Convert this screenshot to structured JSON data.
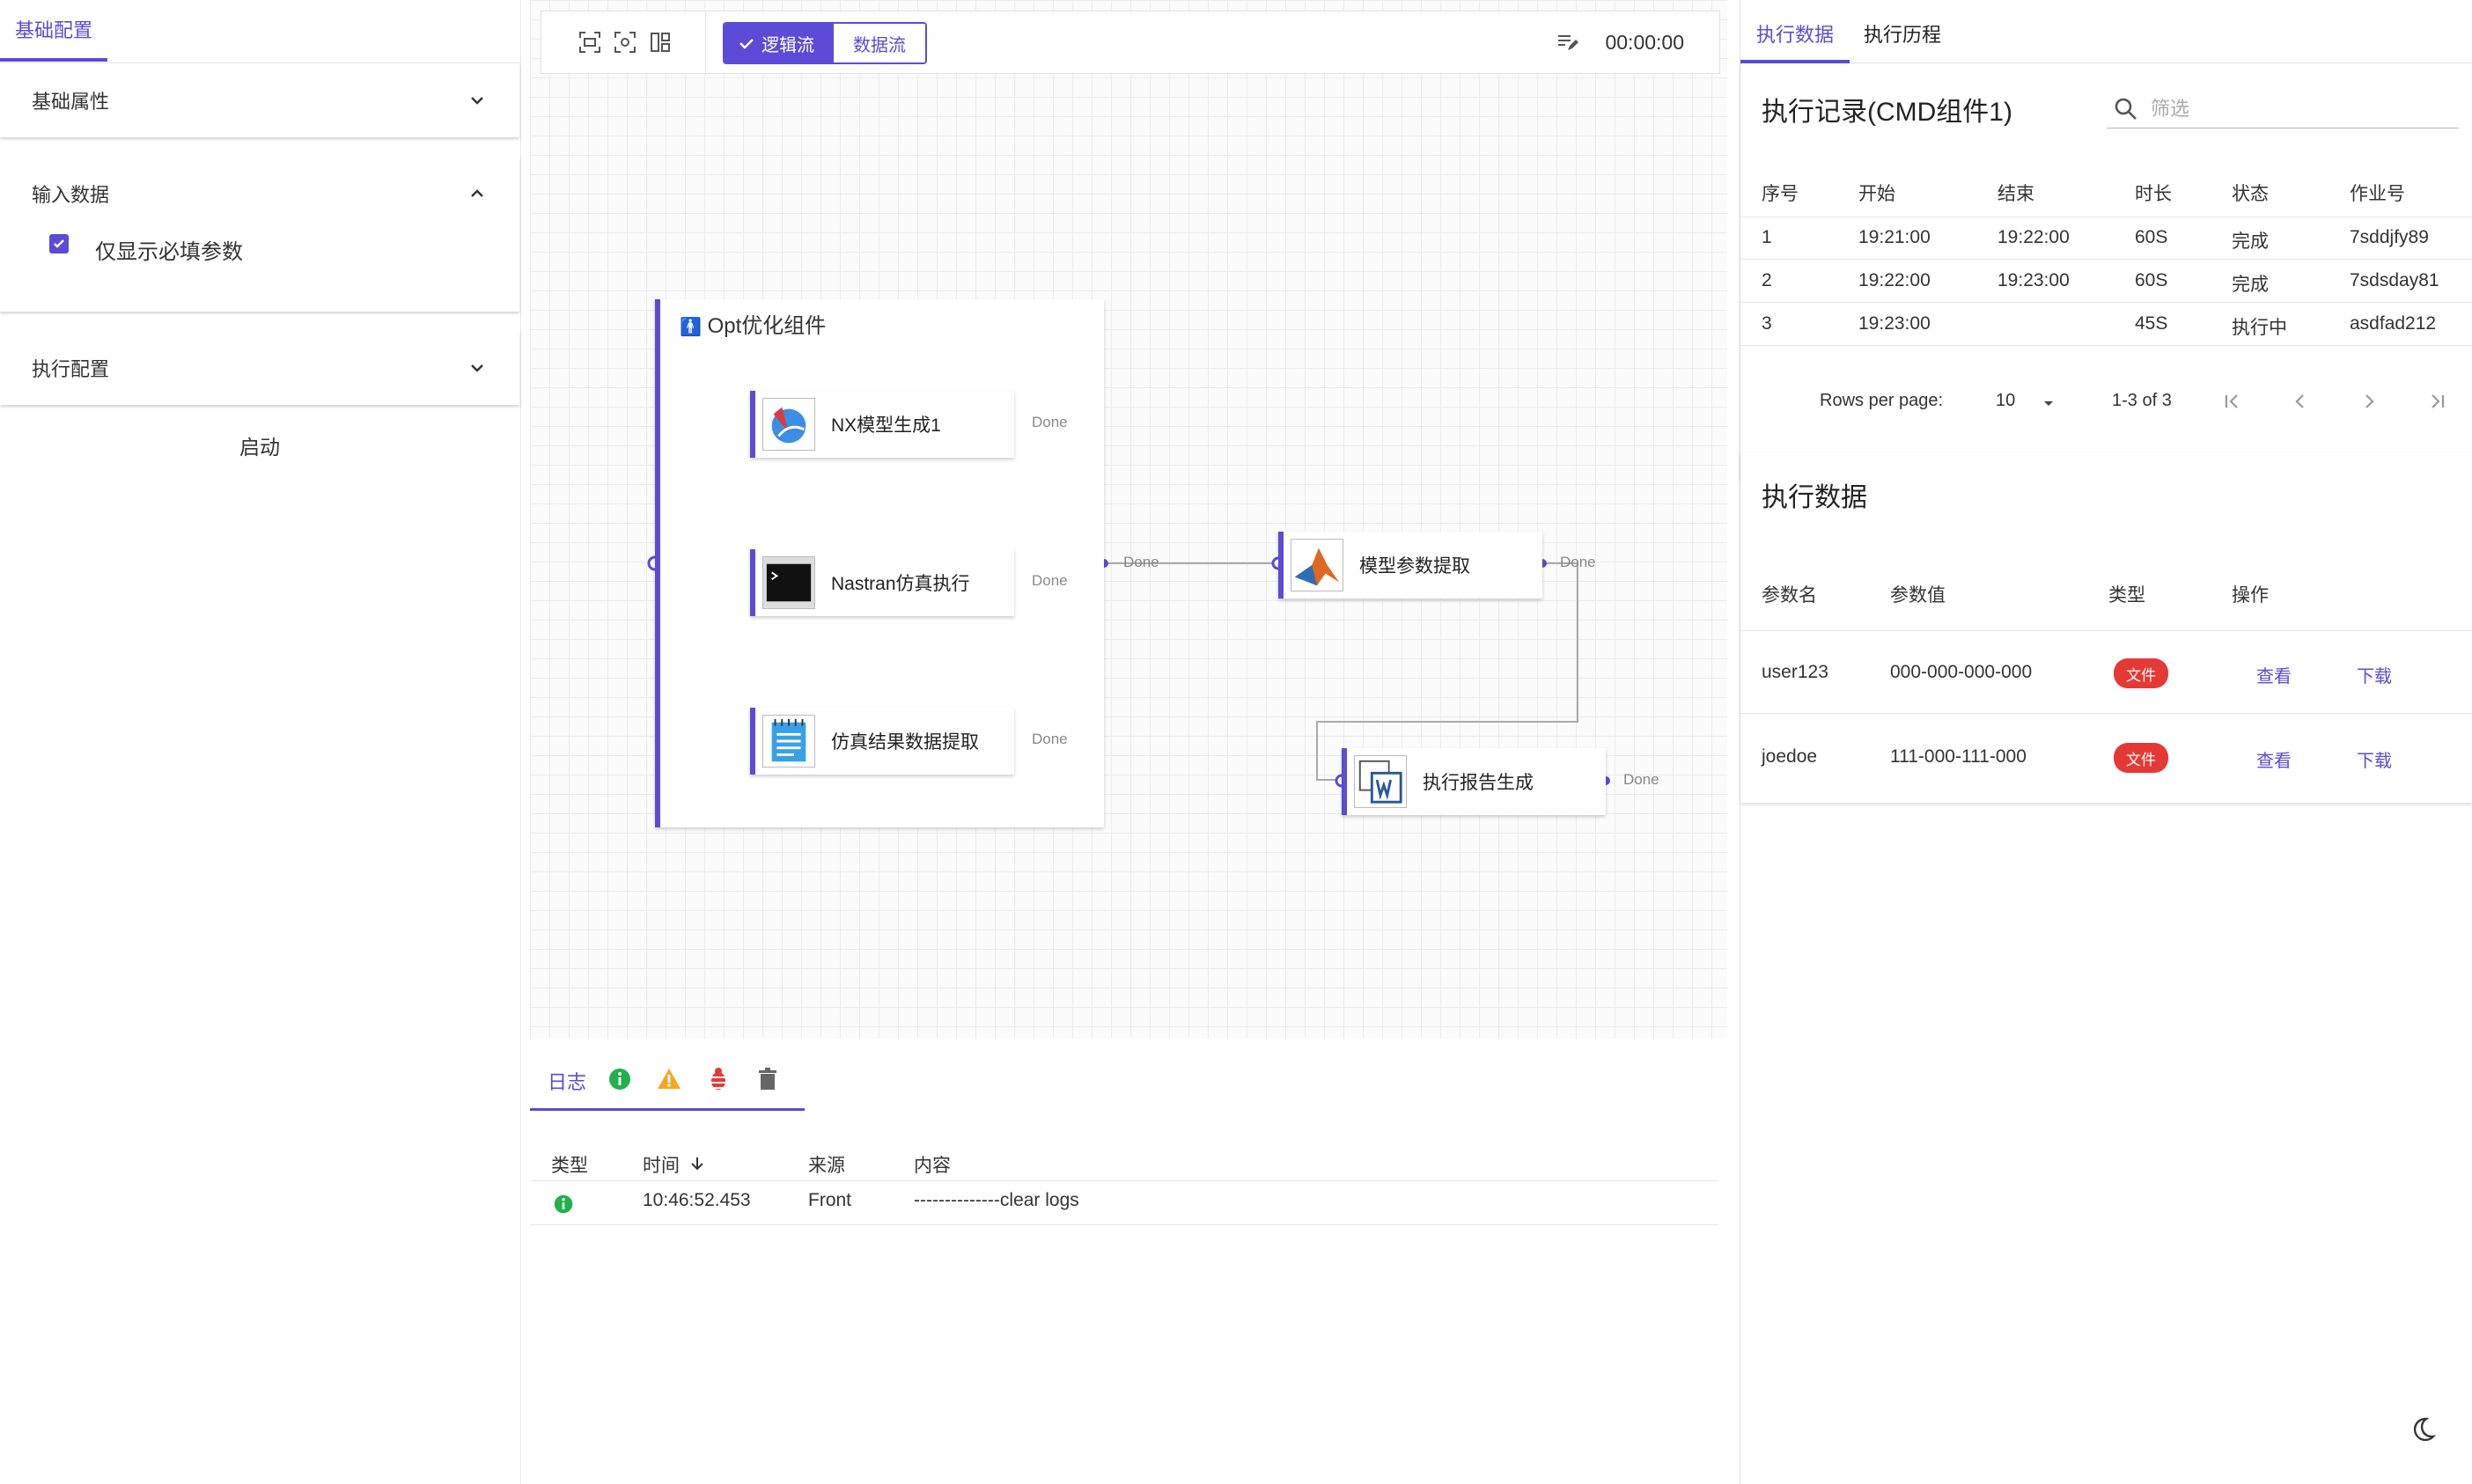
{
  "left_panel": {
    "tab": "基础配置",
    "sections": [
      {
        "label": "基础属性"
      },
      {
        "label": "输入数据"
      },
      {
        "label": "执行配置"
      }
    ],
    "checkbox_label": "仅显示必填参数",
    "start_button": "启动"
  },
  "toolbar": {
    "logic_flow": "逻辑流",
    "data_flow": "数据流",
    "timer": "00:00:00"
  },
  "canvas": {
    "group_title": "Opt优化组件",
    "nodes": [
      {
        "label": "NX模型生成1",
        "port": "Done"
      },
      {
        "label": "Nastran仿真执行",
        "port": "Done"
      },
      {
        "label": "仿真结果数据提取",
        "port": "Done"
      },
      {
        "label": "模型参数提取",
        "port": "Done"
      },
      {
        "label": "执行报告生成",
        "port": "Done"
      }
    ],
    "group_port": "Done"
  },
  "log": {
    "tab": "日志",
    "headers": [
      "类型",
      "时间",
      "来源",
      "内容"
    ],
    "rows": [
      {
        "time": "10:46:52.453",
        "source": "Front",
        "content": "--------------clear logs"
      }
    ]
  },
  "right_panel": {
    "tabs": [
      "执行数据",
      "执行历程"
    ],
    "records_title": "执行记录(CMD组件1)",
    "search_placeholder": "筛选",
    "records_headers": [
      "序号",
      "开始",
      "结束",
      "时长",
      "状态",
      "作业号"
    ],
    "records": [
      {
        "no": "1",
        "start": "19:21:00",
        "end": "19:22:00",
        "duration": "60S",
        "status": "完成",
        "job": "7sddjfy89"
      },
      {
        "no": "2",
        "start": "19:22:00",
        "end": "19:23:00",
        "duration": "60S",
        "status": "完成",
        "job": "7sdsday81"
      },
      {
        "no": "3",
        "start": "19:23:00",
        "end": "",
        "duration": "45S",
        "status": "执行中",
        "job": "asdfad212"
      }
    ],
    "pager": {
      "rows_label": "Rows per page:",
      "rows_value": "10",
      "range": "1-3 of 3"
    },
    "data_title": "执行数据",
    "data_headers": [
      "参数名",
      "参数值",
      "类型",
      "操作"
    ],
    "data_rows": [
      {
        "name": "user123",
        "value": "000-000-000-000",
        "type": "文件",
        "view": "查看",
        "download": "下载"
      },
      {
        "name": "joedoe",
        "value": "111-000-111-000",
        "type": "文件",
        "view": "查看",
        "download": "下载"
      }
    ]
  },
  "colors": {
    "accent": "#5b4bd6",
    "danger": "#e53935",
    "info": "#22b14c",
    "warning": "#f5a623"
  }
}
